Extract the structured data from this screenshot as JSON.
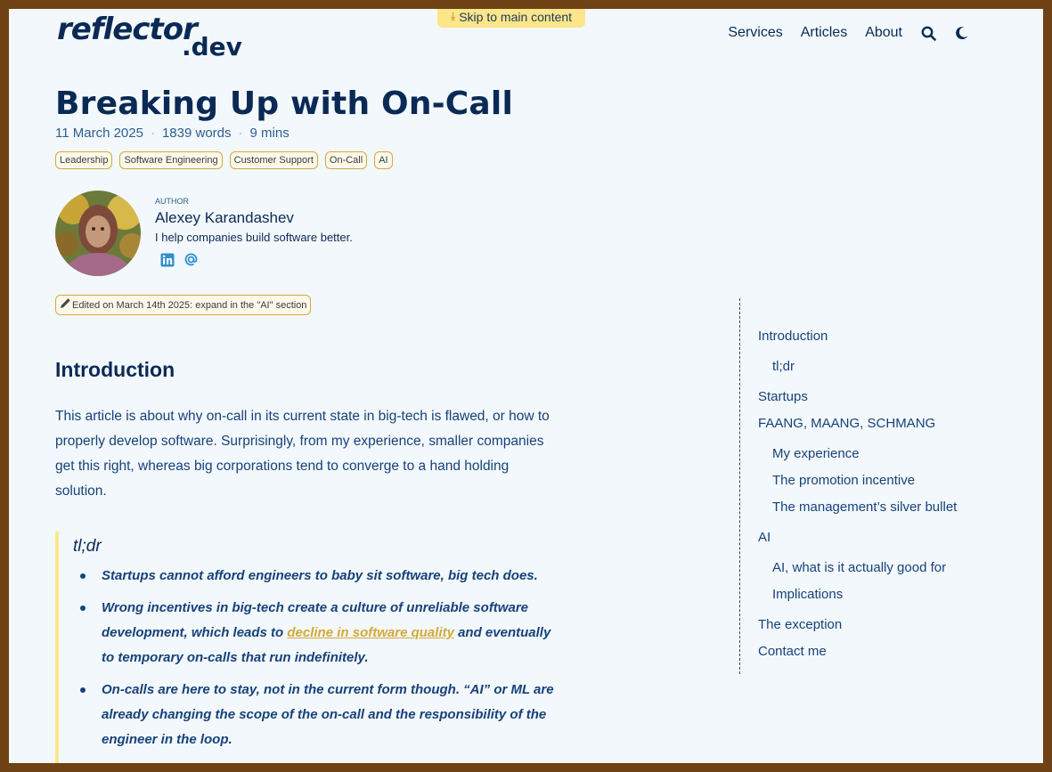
{
  "header": {
    "skip_link": "Skip to main content",
    "logo_text": "reflector.dev",
    "nav": [
      "Services",
      "Articles",
      "About"
    ]
  },
  "article": {
    "title": "Breaking Up with On-Call",
    "date": "11 March 2025",
    "words": "1839 words",
    "read_time": "9 mins",
    "tags": [
      "Leadership",
      "Software Engineering",
      "Customer Support",
      "On-Call",
      "AI"
    ],
    "edit_note": "Edited on March 14th 2025: expand in the \"AI\" section"
  },
  "author": {
    "label": "AUTHOR",
    "name": "Alexey Karandashev",
    "bio": "I help companies build software better."
  },
  "content": {
    "intro_heading": "Introduction",
    "intro_text": "This article is about why on-call in its current state in big-tech is flawed, or how to properly develop software. Surprisingly, from my experience, smaller companies get this right, whereas big corporations tend to converge to a hand holding solution.",
    "tldr_heading": "tl;dr",
    "tldr_1": "Startups cannot afford engineers to baby sit software, big tech does.",
    "tldr_2_pre": "Wrong incentives in big-tech create a culture of unreliable software development, which leads to ",
    "tldr_2_link": "decline in software quality",
    "tldr_2_post": " and eventually to temporary on-calls that run indefinitely.",
    "tldr_3": "On-calls are here to stay, not in the current form though. “AI” or ML are already changing the scope of the on-call and the responsibility of the engineer in the loop."
  },
  "toc": [
    "Introduction",
    "tl;dr",
    "Startups",
    "FAANG, MAANG, SCHMANG",
    "My experience",
    "The promotion incentive",
    "The management’s silver bullet",
    "AI",
    "AI, what is it actually good for",
    "Implications",
    "The exception",
    "Contact me"
  ],
  "colors": {
    "accent": "#fde68a",
    "primary": "#0a2a55",
    "link": "#d4a93a"
  }
}
